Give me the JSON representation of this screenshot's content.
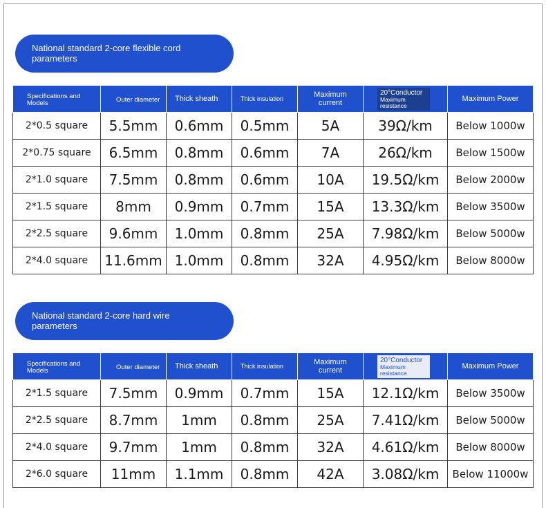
{
  "sections": [
    {
      "title": "National standard 2-core flexible cord parameters",
      "headers": {
        "spec": "Specifications and Models",
        "outer": "Outer diameter",
        "sheath": "Thick sheath",
        "insulation": "Thick insulation",
        "current": "Maximum current",
        "resistance_top": "20°Conductor",
        "resistance_bottom": "Maximum resistance",
        "power": "Maximum Power"
      },
      "rows": [
        {
          "spec": "2*0.5 square",
          "outer": "5.5mm",
          "sheath": "0.6mm",
          "insulation": "0.5mm",
          "current": "5A",
          "resistance": "39Ω/km",
          "power": "Below 1000w"
        },
        {
          "spec": "2*0.75 square",
          "outer": "6.5mm",
          "sheath": "0.8mm",
          "insulation": "0.6mm",
          "current": "7A",
          "resistance": "26Ω/km",
          "power": "Below 1500w"
        },
        {
          "spec": "2*1.0 square",
          "outer": "7.5mm",
          "sheath": "0.8mm",
          "insulation": "0.6mm",
          "current": "10A",
          "resistance": "19.5Ω/km",
          "power": "Below 2000w"
        },
        {
          "spec": "2*1.5 square",
          "outer": "8mm",
          "sheath": "0.9mm",
          "insulation": "0.7mm",
          "current": "15A",
          "resistance": "13.3Ω/km",
          "power": "Below 3500w"
        },
        {
          "spec": "2*2.5 square",
          "outer": "9.6mm",
          "sheath": "1.0mm",
          "insulation": "0.8mm",
          "current": "25A",
          "resistance": "7.98Ω/km",
          "power": "Below 5000w"
        },
        {
          "spec": "2*4.0 square",
          "outer": "11.6mm",
          "sheath": "1.0mm",
          "insulation": "0.8mm",
          "current": "32A",
          "resistance": "4.95Ω/km",
          "power": "Below 8000w"
        }
      ]
    },
    {
      "title": "National standard 2-core hard wire parameters",
      "headers": {
        "spec": "Specifications and Models",
        "outer": "Outer diameter",
        "sheath": "Thick sheath",
        "insulation": "Thick insulation",
        "current": "Maximum current",
        "resistance_top": "20°Conductor",
        "resistance_bottom": "Maximum resistance",
        "power": "Maximum Power"
      },
      "rows": [
        {
          "spec": "2*1.5 square",
          "outer": "7.5mm",
          "sheath": "0.9mm",
          "insulation": "0.7mm",
          "current": "15A",
          "resistance": "12.1Ω/km",
          "power": "Below 3500w"
        },
        {
          "spec": "2*2.5 square",
          "outer": "8.7mm",
          "sheath": "1mm",
          "insulation": "0.8mm",
          "current": "25A",
          "resistance": "7.41Ω/km",
          "power": "Below 5000w"
        },
        {
          "spec": "2*4.0 square",
          "outer": "9.7mm",
          "sheath": "1mm",
          "insulation": "0.8mm",
          "current": "32A",
          "resistance": "4.61Ω/km",
          "power": "Below 8000w"
        },
        {
          "spec": "2*6.0 square",
          "outer": "11mm",
          "sheath": "1.1mm",
          "insulation": "0.8mm",
          "current": "42A",
          "resistance": "3.08Ω/km",
          "power": "Below 11000w"
        }
      ]
    }
  ],
  "colors": {
    "accent": "#2150cf",
    "header_dark": "#1c3f8f",
    "border": "#3c3c3c"
  }
}
